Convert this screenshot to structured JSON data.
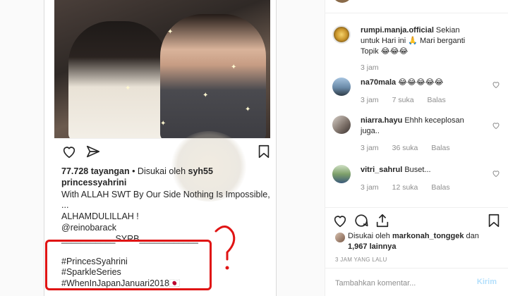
{
  "post_screenshot": {
    "views": "77.728 tayangan",
    "liked_by_prefix": "• Disukai oleh",
    "liked_by_user": "syh55",
    "caption_user": "princessyahrini",
    "caption_lines": [
      "With ALLAH SWT By Our Side Nothing Is Impossible,",
      "...",
      "ALHAMDULILLAH !",
      "@reinobarack",
      "___________SYRB____________"
    ],
    "hashtags": [
      "#PrincesSyahrini",
      "#SparkleSeries",
      "#WhenInJapanJanuari2018🇯🇵"
    ]
  },
  "comments": [
    {
      "user": "rumpi.manja.official",
      "text": "Sekian untuk Hari ini 🙏 Mari berganti Topik 😂😂😂",
      "time": "3 jam",
      "likes": "",
      "reply": ""
    },
    {
      "user": "na70mala",
      "text": "😂😂😂😂😂",
      "time": "3 jam",
      "likes": "7 suka",
      "reply": "Balas"
    },
    {
      "user": "niarra.hayu",
      "text": "Ehhh keceplosan juga..",
      "time": "3 jam",
      "likes": "36 suka",
      "reply": "Balas"
    },
    {
      "user": "vitri_sahrul",
      "text": "Buset...",
      "time": "3 jam",
      "likes": "12 suka",
      "reply": "Balas"
    }
  ],
  "footer": {
    "liked_prefix": "Disukai oleh",
    "liked_user": "markonah_tonggek",
    "liked_and": "dan",
    "liked_count": "1,967 lainnya",
    "time_ago": "3 JAM YANG LALU",
    "input_placeholder": "Tambahkan komentar...",
    "send_label": "Kirim"
  },
  "colors": {
    "accent": "#0095f6",
    "send_disabled": "#b2dffc",
    "highlight_box": "#e01414",
    "muted_text": "#8e8e8e"
  },
  "icons": [
    "heart-icon",
    "share-icon",
    "bookmark-icon",
    "comment-icon",
    "upload-icon"
  ]
}
